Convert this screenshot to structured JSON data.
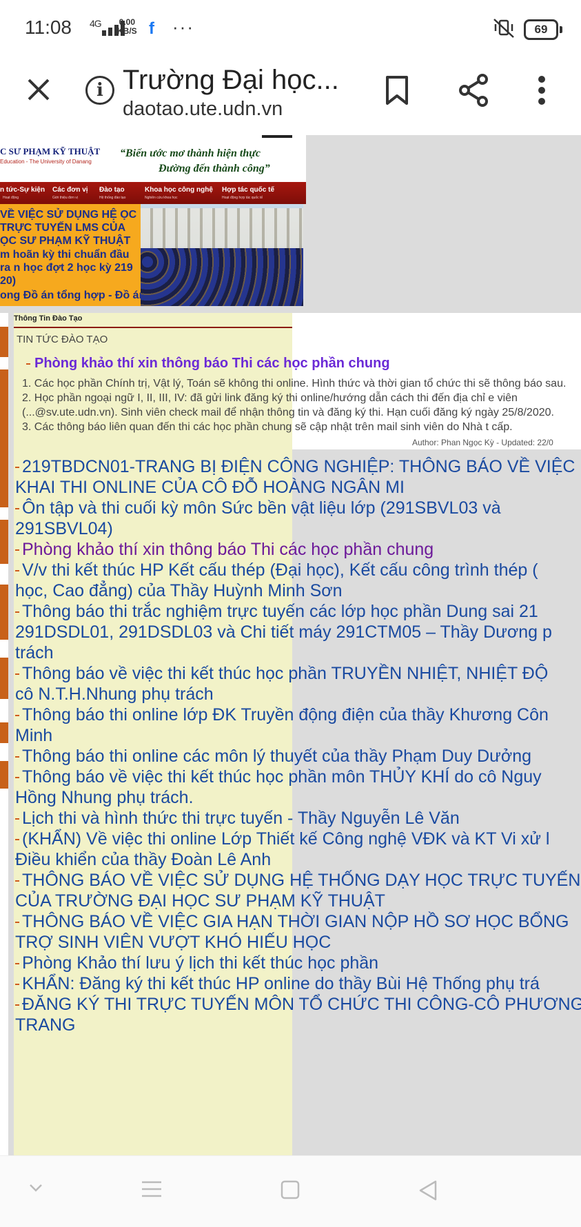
{
  "status_bar": {
    "time": "11:08",
    "network": "4G",
    "speed": "0.00",
    "speed_unit": "KB/S",
    "battery": "69",
    "fb_glyph": "f",
    "more_glyph": "···"
  },
  "browser": {
    "page_title": "Trường Đại học...",
    "url": "daotao.ute.udn.vn"
  },
  "banner": {
    "school_name": "C SƯ PHẠM KỸ THUẬT",
    "school_name_en": "Education - The University of Danang",
    "slogan_line1": "“Biến ước mơ thành hiện thực",
    "slogan_line2": "Đường đến thành công”",
    "nav": [
      {
        "label": "n tức-Sự kiện",
        "sub": "Hoạt động"
      },
      {
        "label": "Các đơn vị",
        "sub": "Giới thiệu đơn vị"
      },
      {
        "label": "Đào tạo",
        "sub": "Hệ thống đào tạo"
      },
      {
        "label": "Khoa học công nghệ",
        "sub": "Nghiên cứu khoa học"
      },
      {
        "label": "Hợp tác quốc tế",
        "sub": "Hoạt động hợp tác quốc tế"
      }
    ],
    "yellow_news": [
      "VỀ VIỆC SỬ DỤNG HỆ ỌC TRỰC TUYẾN LMS CỦA ỌC SƯ PHẠM KỸ THUẬT",
      "m hoãn kỳ thi chuẩn đầu ra n học đợt 2 học kỳ 219 20)",
      "ong Đồ án tổng hợp - Đồ án"
    ]
  },
  "panel": {
    "header": "Thông Tin Đào Tạo",
    "subheader": "TIN TỨC ĐÀO TẠO"
  },
  "featured": {
    "title": "Phòng khảo thí xin thông báo Thi các học phần chung",
    "body": "1. Các học phần Chính trị, Vật lý, Toán sẽ không thi online. Hình thức và thời gian tổ chức thi sẽ thông báo sau.\n2. Học phần ngoại ngữ I, II, III, IV: đã gửi link đăng ký thi online/hướng dẫn cách thi đến địa chỉ e viên (...@sv.ute.udn.vn). Sinh viên check mail để nhận thông tin và đăng ký thi. Hạn cuối đăng ký ngày 25/8/2020.\n3. Các thông báo liên quan đến thi các học phần chung sẽ cập nhật trên mail sinh viên do Nhà t cấp.",
    "author": "Author: Phan Ngọc Kỳ - Updated: 22/0"
  },
  "news": [
    {
      "text": "219TBDCN01-TRANG BỊ ĐIỆN CÔNG NGHIỆP: THÔNG BÁO VỀ VIỆC\nKHAI THI ONLINE CỦA CÔ ĐỖ HOÀNG NGÂN MI"
    },
    {
      "text": "Ôn tập và thi cuối kỳ môn Sức bền vật liệu lớp (291SBVL03 và\n291SBVL04)"
    },
    {
      "text": "Phòng khảo thí xin thông báo Thi các học phần chung",
      "visited": true
    },
    {
      "text": "V/v thi kết thúc HP Kết cấu thép (Đại học), Kết cấu công trình thép (\nhọc, Cao đẳng) của Thầy Huỳnh Minh Sơn"
    },
    {
      "text": "Thông báo thi trắc nghiệm trực tuyến các lớp học phần Dung sai 21\n291DSDL01, 291DSDL03 và Chi tiết máy 291CTM05 – Thầy Dương p\ntrách"
    },
    {
      "text": "Thông báo về việc thi kết thúc học phần TRUYỀN NHIỆT, NHIỆT ĐỘ\ncô N.T.H.Nhung phụ trách"
    },
    {
      "text": "Thông báo thi online lớp ĐK Truyền động điện của thầy Khương Côn\nMinh"
    },
    {
      "text": "Thông báo thi online các môn lý thuyết của thầy Phạm Duy Dưởng"
    },
    {
      "text": "Thông báo về việc thi kết thúc học phần môn THỦY KHÍ do cô Nguy\nHồng Nhung phụ trách."
    },
    {
      "text": "Lịch thi và hình thức thi trực tuyến - Thầy Nguyễn Lê Văn"
    },
    {
      "text": "(KHẨN) Về việc thi online Lớp Thiết kế Công nghệ VĐK và KT Vi xử l\nĐiều khiển của thầy Đoàn Lê Anh"
    },
    {
      "text": "THÔNG BÁO VỀ VIỆC SỬ DỤNG HỆ THỐNG DẠY HỌC TRỰC TUYẾN\nCỦA TRƯỜNG ĐẠI HỌC SƯ PHẠM KỸ THUẬT"
    },
    {
      "text": "THÔNG BÁO VỀ VIỆC GIA HẠN THỜI GIAN NỘP HỒ SƠ HỌC BỔNG\nTRỢ SINH VIÊN VƯỢT KHÓ HIẾU HỌC"
    },
    {
      "text": "Phòng Khảo thí lưu ý lịch thi kết thúc học phần"
    },
    {
      "text": "KHẨN: Đăng ký thi kết thúc HP online do thầy Bùi Hệ Thống phụ trá"
    },
    {
      "text": "ĐĂNG KÝ THI TRỰC TUYẾN MÔN TỔ CHỨC THI CÔNG-CÔ PHƯƠNG\nTRANG"
    }
  ]
}
